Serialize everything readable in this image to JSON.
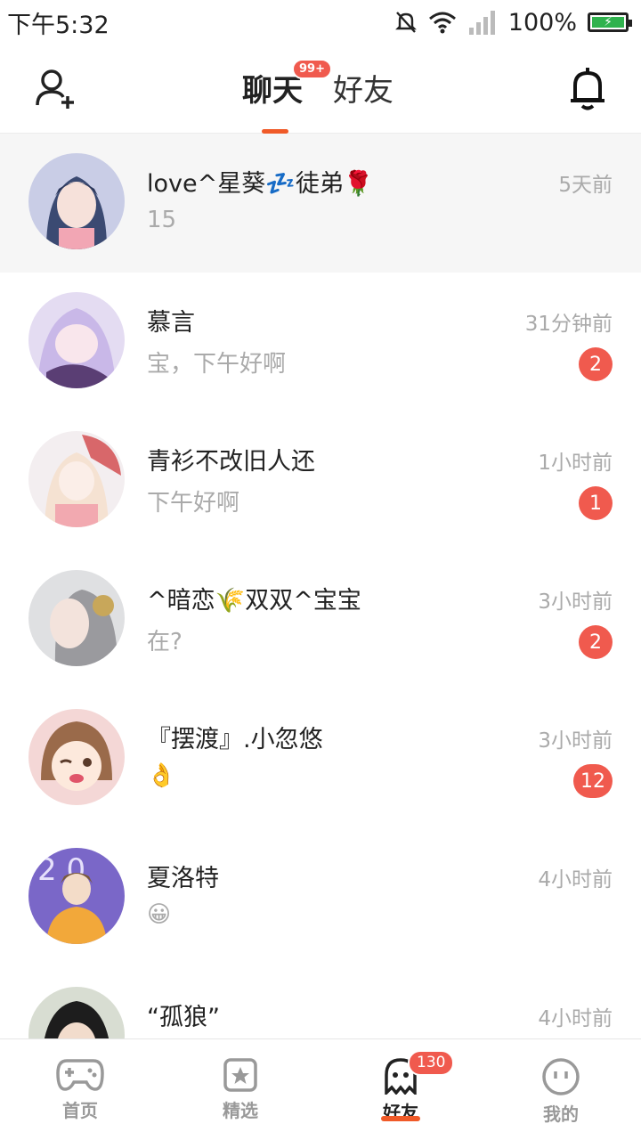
{
  "status_bar": {
    "time": "下午5:32",
    "battery_text": "100%",
    "icons": [
      "bell-muted-icon",
      "wifi-icon",
      "signal-icon",
      "battery-icon"
    ]
  },
  "header": {
    "add_friend_icon": "add-friend-icon",
    "bell_icon": "bell-icon",
    "tabs": [
      {
        "label": "聊天",
        "badge": "99+",
        "active": true
      },
      {
        "label": "好友",
        "active": false
      }
    ]
  },
  "chats": [
    {
      "name": "love^星葵💤徒弟🌹",
      "preview": "15",
      "time": "5天前",
      "unread": ""
    },
    {
      "name": "慕言",
      "preview": "宝，下午好啊",
      "time": "31分钟前",
      "unread": "2"
    },
    {
      "name": "青衫不改旧人还",
      "preview": "下午好啊",
      "time": "1小时前",
      "unread": "1"
    },
    {
      "name": "^暗恋🌾双双^宝宝",
      "preview": "在?",
      "time": "3小时前",
      "unread": "2"
    },
    {
      "name": "『摆渡』.小忽悠",
      "preview": "👌",
      "time": "3小时前",
      "unread": "12"
    },
    {
      "name": "夏洛特",
      "preview": "😀",
      "time": "4小时前",
      "unread": ""
    },
    {
      "name": "“孤狼”",
      "preview": "",
      "time": "4小时前",
      "unread": ""
    }
  ],
  "bottom_nav": {
    "items": [
      {
        "label": "首页",
        "icon": "gamepad-icon"
      },
      {
        "label": "精选",
        "icon": "star-icon"
      },
      {
        "label": "好友",
        "icon": "ghost-icon",
        "badge": "130",
        "active": true
      },
      {
        "label": "我的",
        "icon": "face-icon"
      }
    ]
  },
  "colors": {
    "accent": "#f05a28",
    "badge": "#f05a4e"
  }
}
